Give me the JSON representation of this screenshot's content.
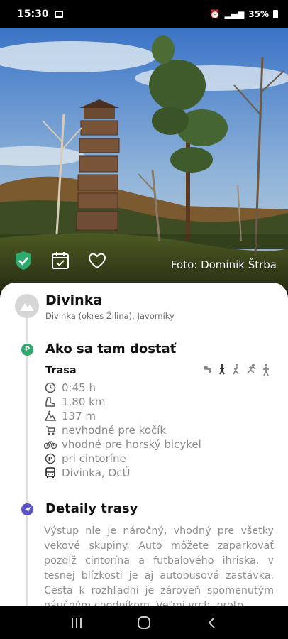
{
  "status_bar": {
    "time": "15:30",
    "right_text": "35%"
  },
  "hero": {
    "photo_credit": "Foto: Dominik Štrba"
  },
  "place": {
    "name": "Divinka",
    "location": "Divinka (okres Žilina), Javorníky"
  },
  "how_to_get": {
    "title": "Ako sa tam dostať",
    "route_label": "Trasa",
    "facts": [
      {
        "icon": "clock-icon",
        "text": "0:45 h"
      },
      {
        "icon": "boot-icon",
        "text": "1,80 km"
      },
      {
        "icon": "elevation-icon",
        "text": "137 m"
      },
      {
        "icon": "stroller-icon",
        "text": "nevhodné pre kočík"
      },
      {
        "icon": "bicycle-icon",
        "text": "vhodné pre horský bicykel"
      },
      {
        "icon": "parking-icon",
        "text": "pri cintoríne"
      },
      {
        "icon": "bus-icon",
        "text": "Divinka, OcÚ"
      }
    ]
  },
  "route_details": {
    "title": "Detaily trasy",
    "text": "Výstup nie je náročný, vhodný pre všetky vekové skupiny. Auto môžete zaparkovať pozdĺž cintorína a futbalového ihriska, v tesnej blízkosti je aj autobusová zastávka. Cesta k rozhľadni je zároveň spomenutým náučným chodníkom. Veľmi vrch, proto"
  },
  "colors": {
    "accent_green": "#2eaa6c",
    "accent_purple": "#5b55c9"
  }
}
